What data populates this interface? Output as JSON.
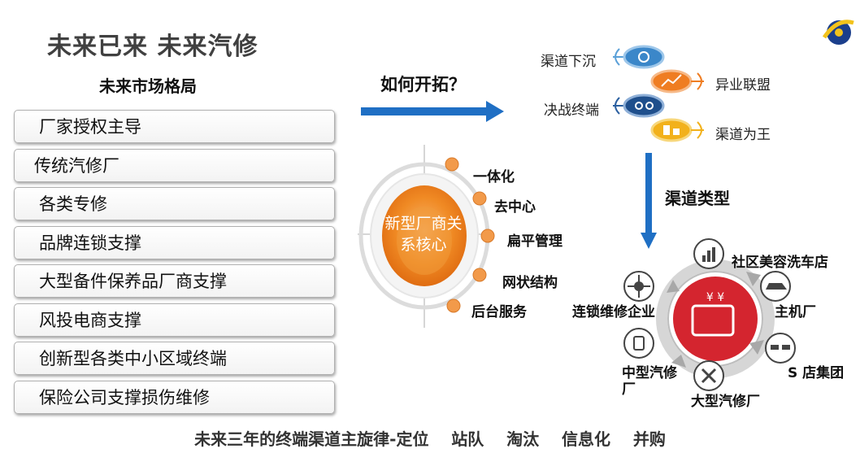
{
  "title": "未来已来 未来汽修",
  "subtitle": "未来市场格局",
  "list": [
    "厂家授权主导",
    "传统汽修厂",
    "各类专修",
    "品牌连锁支撑",
    "大型备件保养品厂商支撑",
    "风投电商支撑",
    "创新型各类中小区域终端",
    "保险公司支撑损伤维修"
  ],
  "question": "如何开拓？",
  "core": {
    "label": "新型厂商关系核心",
    "features": [
      "一体化",
      "去中心",
      "扁平管理",
      "网状结构",
      "后台服务"
    ]
  },
  "strategies": [
    "渠道下沉",
    "异业联盟",
    "决战终端",
    "渠道为王"
  ],
  "channels_label": "渠道类型",
  "channel_types": [
    "社区美容洗车店",
    "主机厂",
    "S 店集团",
    "大型汽修厂",
    "中型汽修厂",
    "连锁维修企业"
  ],
  "footer": "未来三年的终端渠道主旋律-定位    站队    淘汰    信息化    并购",
  "colors": {
    "accent_blue": "#1f6fc4",
    "orange": "#f08a24",
    "red": "#d4252f",
    "gray": "#b5b5b5"
  }
}
